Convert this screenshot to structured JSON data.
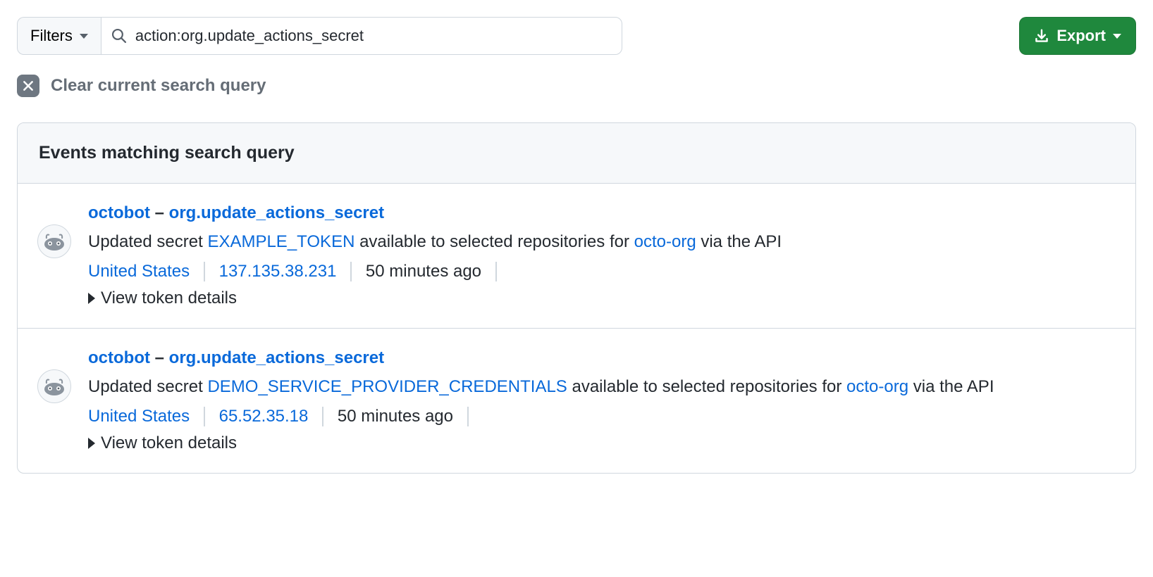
{
  "toolbar": {
    "filters_label": "Filters",
    "search_value": "action:org.update_actions_secret",
    "export_label": "Export"
  },
  "clear": {
    "label": "Clear current search query"
  },
  "panel": {
    "header": "Events matching search query"
  },
  "events": [
    {
      "actor": "octobot",
      "dash": " – ",
      "action": "org.update_actions_secret",
      "desc_prefix": "Updated secret ",
      "secret_name": "EXAMPLE_TOKEN",
      "desc_mid": " available to selected repositories for ",
      "org": "octo-org",
      "desc_suffix": " via the API",
      "location": "United States",
      "ip": "137.135.38.231",
      "time": "50 minutes ago",
      "details_label": "View token details"
    },
    {
      "actor": "octobot",
      "dash": " – ",
      "action": "org.update_actions_secret",
      "desc_prefix": "Updated secret ",
      "secret_name": "DEMO_SERVICE_PROVIDER_CREDENTIALS",
      "desc_mid": " available to selected repositories for ",
      "org": "octo-org",
      "desc_suffix": " via the API",
      "location": "United States",
      "ip": "65.52.35.18",
      "time": "50 minutes ago",
      "details_label": "View token details"
    }
  ]
}
